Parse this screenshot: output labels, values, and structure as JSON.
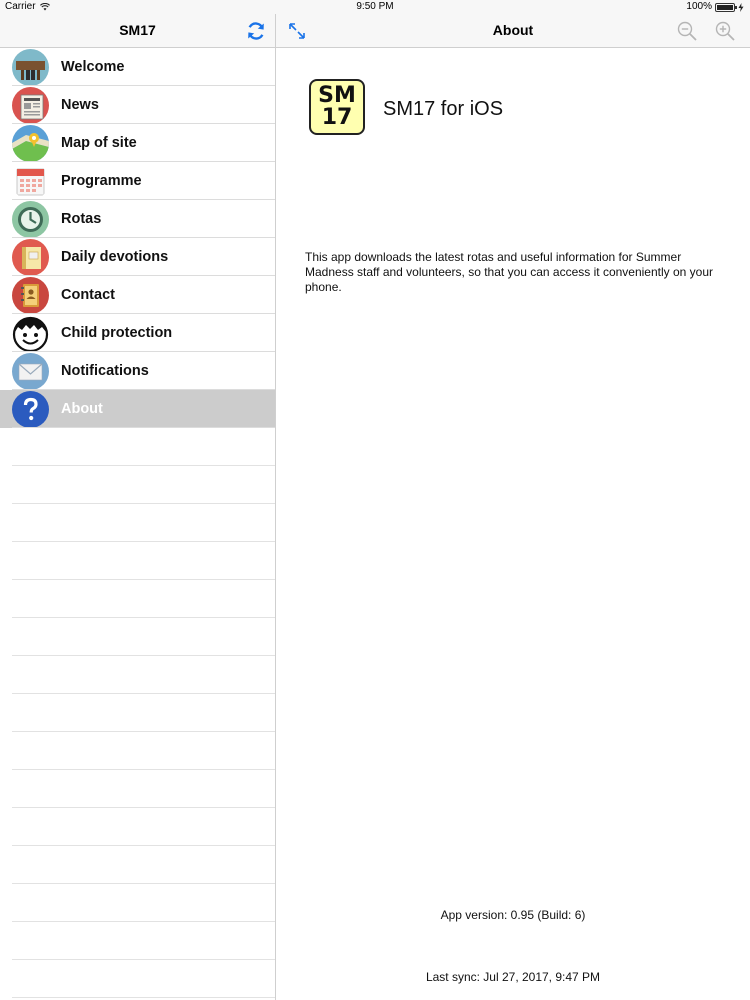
{
  "status_bar": {
    "carrier": "Carrier",
    "time": "9:50 PM",
    "battery_percent": "100%",
    "battery_level": 1.0
  },
  "sidebar": {
    "title": "SM17",
    "refresh_icon": "refresh-icon",
    "items": [
      {
        "label": "Welcome",
        "icon": "welcome-icon",
        "color": "#7fb9c9"
      },
      {
        "label": "News",
        "icon": "news-icon",
        "color": "#d9534f"
      },
      {
        "label": "Map of site",
        "icon": "map-icon",
        "color": "#5aa0d6"
      },
      {
        "label": "Programme",
        "icon": "calendar-icon",
        "color": "#ffffff"
      },
      {
        "label": "Rotas",
        "icon": "clock-icon",
        "color": "#8dc6a3"
      },
      {
        "label": "Daily devotions",
        "icon": "book-icon",
        "color": "#e05a4f"
      },
      {
        "label": "Contact",
        "icon": "address-book-icon",
        "color": "#c9473f"
      },
      {
        "label": "Child protection",
        "icon": "child-face-icon",
        "color": "#ffffff"
      },
      {
        "label": "Notifications",
        "icon": "envelope-icon",
        "color": "#79a8cf"
      },
      {
        "label": "About",
        "icon": "question-icon",
        "color": "#2b5bbf"
      }
    ],
    "selected_index": 9
  },
  "detail": {
    "title": "About",
    "expand_icon": "expand-icon",
    "zoom_out_icon": "zoom-out-icon",
    "zoom_in_icon": "zoom-in-icon",
    "logo_line1": "SM",
    "logo_line2": "17",
    "app_name": "SM17 for iOS",
    "description": "This app downloads the latest rotas and useful information for Summer Madness staff and volunteers, so that you can access it conveniently on your phone.",
    "app_version": "App version: 0.95 (Build: 6)",
    "last_sync": "Last sync: Jul 27, 2017, 9:47 PM"
  },
  "colors": {
    "accent": "#1a73e8",
    "selected_row": "#cccccc",
    "logo_bg": "#ffffb0"
  }
}
